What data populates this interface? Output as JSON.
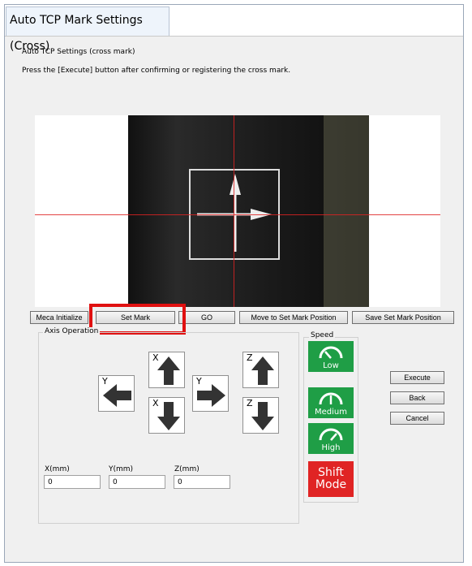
{
  "window": {
    "title": "Auto TCP Mark Settings (Cross)"
  },
  "heading": "Auto TCP Settings (cross mark)",
  "instruction": "Press the [Execute] button after confirming or registering the cross mark.",
  "buttons": {
    "meca_initialize": "Meca Initialize",
    "set_mark": "Set Mark",
    "go": "GO",
    "move_to_set_mark": "Move to Set Mark Position",
    "save_set_mark": "Save Set Mark Position"
  },
  "axis_operation": {
    "title": "Axis Operation",
    "x_label": "X",
    "y_label": "Y",
    "z_label": "Z"
  },
  "coords": {
    "x_label": "X(mm)",
    "x_value": "0",
    "y_label": "Y(mm)",
    "y_value": "0",
    "z_label": "Z(mm)",
    "z_value": "0"
  },
  "speed": {
    "title": "Speed",
    "low": "Low",
    "medium": "Medium",
    "high": "High",
    "shift_line1": "Shift",
    "shift_line2": "Mode"
  },
  "actions": {
    "execute": "Execute",
    "back": "Back",
    "cancel": "Cancel"
  },
  "colors": {
    "speed_green": "#1f9e46",
    "shift_red": "#e02424",
    "highlight_red": "#e01010"
  }
}
